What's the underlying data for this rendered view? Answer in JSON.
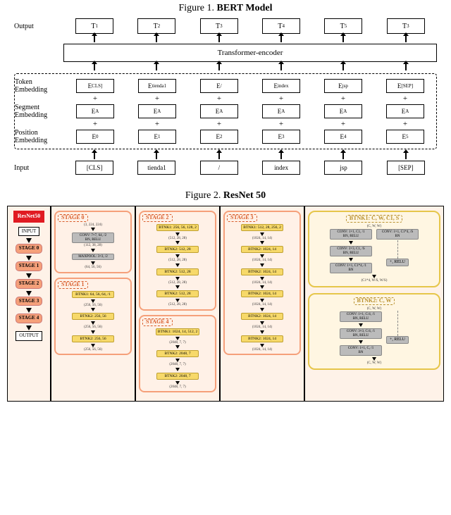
{
  "fig1": {
    "caption_prefix": "Figure 1. ",
    "caption_bold": "BERT Model",
    "rows": {
      "output": "Output",
      "token": "Token\nEmbedding",
      "segment": "Segment\nEmbedding",
      "position": "Position\nEmbedding",
      "input": "Input"
    },
    "encoder": "Transformer-encoder",
    "outputs": [
      "T",
      "T",
      "T",
      "T",
      "T",
      "T"
    ],
    "output_subs": [
      "1",
      "2",
      "3",
      "4",
      "5",
      "3"
    ],
    "token_e": [
      "E",
      "E",
      "E",
      "E",
      "E",
      "E"
    ],
    "token_subs": [
      "CLS]",
      "tienda1",
      "/",
      "index",
      "jsp",
      "[SEP]"
    ],
    "segment_e": [
      "E",
      "E",
      "E",
      "E",
      "E",
      "E"
    ],
    "segment_subs": [
      "A",
      "A",
      "A",
      "A",
      "A",
      "A"
    ],
    "position_e": [
      "E",
      "E",
      "E",
      "E",
      "E",
      "E"
    ],
    "position_subs": [
      "0",
      "1",
      "2",
      "3",
      "4",
      "5"
    ],
    "inputs": [
      "[CLS]",
      "tienda1",
      "/",
      "index",
      "jsp",
      "[SEP]"
    ],
    "plus": "+"
  },
  "fig2": {
    "caption_prefix": "Figure 2. ",
    "caption_bold": "ResNet 50",
    "pipeline": {
      "badge": "ResNet50",
      "input": "INPUT",
      "stages": [
        "STAGE 0",
        "STAGE 1",
        "STAGE 2",
        "STAGE 3",
        "STAGE 4"
      ],
      "output": "OUTPUT"
    },
    "stage0": {
      "title": "STAGE 0",
      "in_shape": "(3, 224, 224)",
      "conv": "CONV: 7×7, 64, /2\nBN, RELU",
      "shape1": "(112, 38, 28)",
      "maxpool": "MAXPOOL: 3×3, /2",
      "out_shape": "(64, 56, 56)"
    },
    "stage1": {
      "title": "STAGE 1",
      "b1": "BTNK1: 64, 56, 64, /1",
      "s1": "(256, 56, 56)",
      "b2": "BTNK2: 256, 56",
      "s2": "(256, 56, 56)",
      "b3": "BTNK2: 256, 56",
      "s3": "(256, 56, 56)"
    },
    "stage2": {
      "title": "STAGE 2",
      "b1": "BTNK1: 256, 56, 128, 2",
      "s1": "(512, 28, 28)",
      "b2": "BTNK2: 512, 28",
      "s2": "(512, 28, 28)",
      "b3": "BTNK2: 512, 28",
      "s3": "(512, 28, 28)",
      "b4": "BTNK2: 512, 28",
      "s4": "(512, 28, 28)"
    },
    "stage3": {
      "title": "STAGE 3",
      "b1": "BTNK1: 512, 28, 256, 2",
      "s1": "(1024, 14, 14)",
      "b2": "BTNK2: 1024, 14",
      "s2": "(1024, 14, 14)",
      "b3": "BTNK2: 1024, 14",
      "s3": "(1024, 14, 14)",
      "b4": "BTNK2: 1024, 14",
      "s4": "(1024, 14, 14)",
      "b5": "BTNK2: 1024, 14",
      "s5": "(1024, 14, 14)",
      "b6": "BTNK2: 1024, 14",
      "s6": "(1024, 14, 14)"
    },
    "stage4": {
      "title": "STAGE 4",
      "b1": "BTNK1: 1024, 14, 512, 2",
      "s1": "(2048, 7, 7)",
      "b2": "BTNK2: 2048, 7",
      "s2": "(2048, 7, 7)",
      "b3": "BTNK2: 2048, 7",
      "s3": "(2048, 7, 7)"
    },
    "btnk1": {
      "title": "BTNK1: C, W, C1, S",
      "in_shape": "(C, W, W)",
      "left": [
        "CONV: 1×1, C1, /1\nBN, RELU",
        "CONV: 3×3, C1, /S\nBN, RELU",
        "CONV: 1×1, C1*4, /1\nBN"
      ],
      "right": "CONV: 1×1, C1*4, /S\nBN",
      "plus": "+, RELU",
      "out_shape": "(C1*4, W/S, W/S)"
    },
    "btnk2": {
      "title": "BTNK2: C, W",
      "in_shape": "(C, W, W)",
      "left": [
        "CONV: 1×1, C/4, /1\nBN, RELU",
        "CONV: 3×3, C/4, /1\nBN, RELU",
        "CONV: 1×1, C, /1\nBN"
      ],
      "plus": "+, RELU",
      "out_shape": "(C, W, W)"
    }
  }
}
